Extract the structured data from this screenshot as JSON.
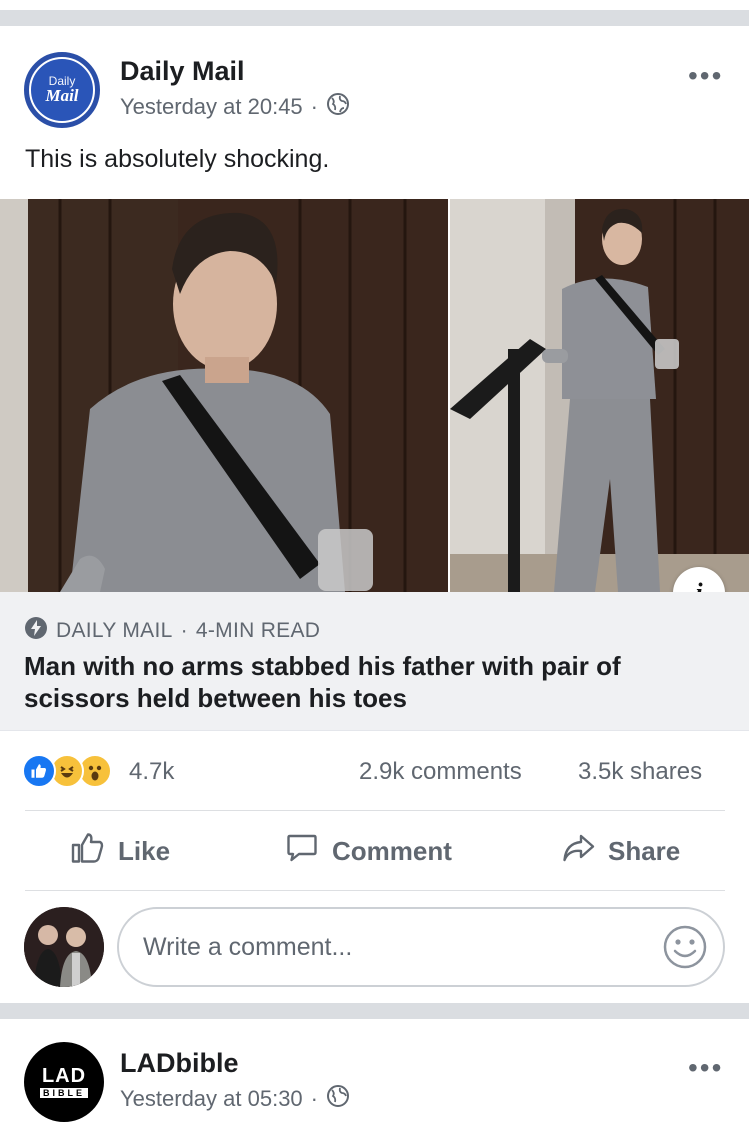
{
  "post": {
    "page_name": "Daily Mail",
    "avatar_top": "Daily",
    "avatar_bottom": "Mail",
    "timestamp": "Yesterday at 20:45",
    "separator": "·",
    "privacy_icon": "globe-icon",
    "more_label": "•••",
    "caption": "This is absolutely shocking.",
    "info_label": "i",
    "link": {
      "source": "DAILY MAIL",
      "read_time": "4-MIN READ",
      "title": "Man with no arms stabbed his father with pair of scissors held between his toes"
    },
    "stats": {
      "reactions": "4.7k",
      "comments": "2.9k comments",
      "shares": "3.5k shares",
      "reaction_icons": [
        "like-icon",
        "haha-icon",
        "wow-icon"
      ]
    },
    "actions": {
      "like": "Like",
      "comment": "Comment",
      "share": "Share"
    },
    "comment_placeholder": "Write a comment..."
  },
  "next_post": {
    "page_name": "LADbible",
    "avatar_top": "LAD",
    "avatar_bottom": "BIBLE",
    "timestamp": "Yesterday at 05:30",
    "separator": "·",
    "more_label": "•••"
  },
  "colors": {
    "brand_blue": "#2b4fa8",
    "like_blue": "#1877f2",
    "secondary_text": "#606770",
    "link_bg": "#f0f1f3",
    "gap": "#dadde1"
  }
}
